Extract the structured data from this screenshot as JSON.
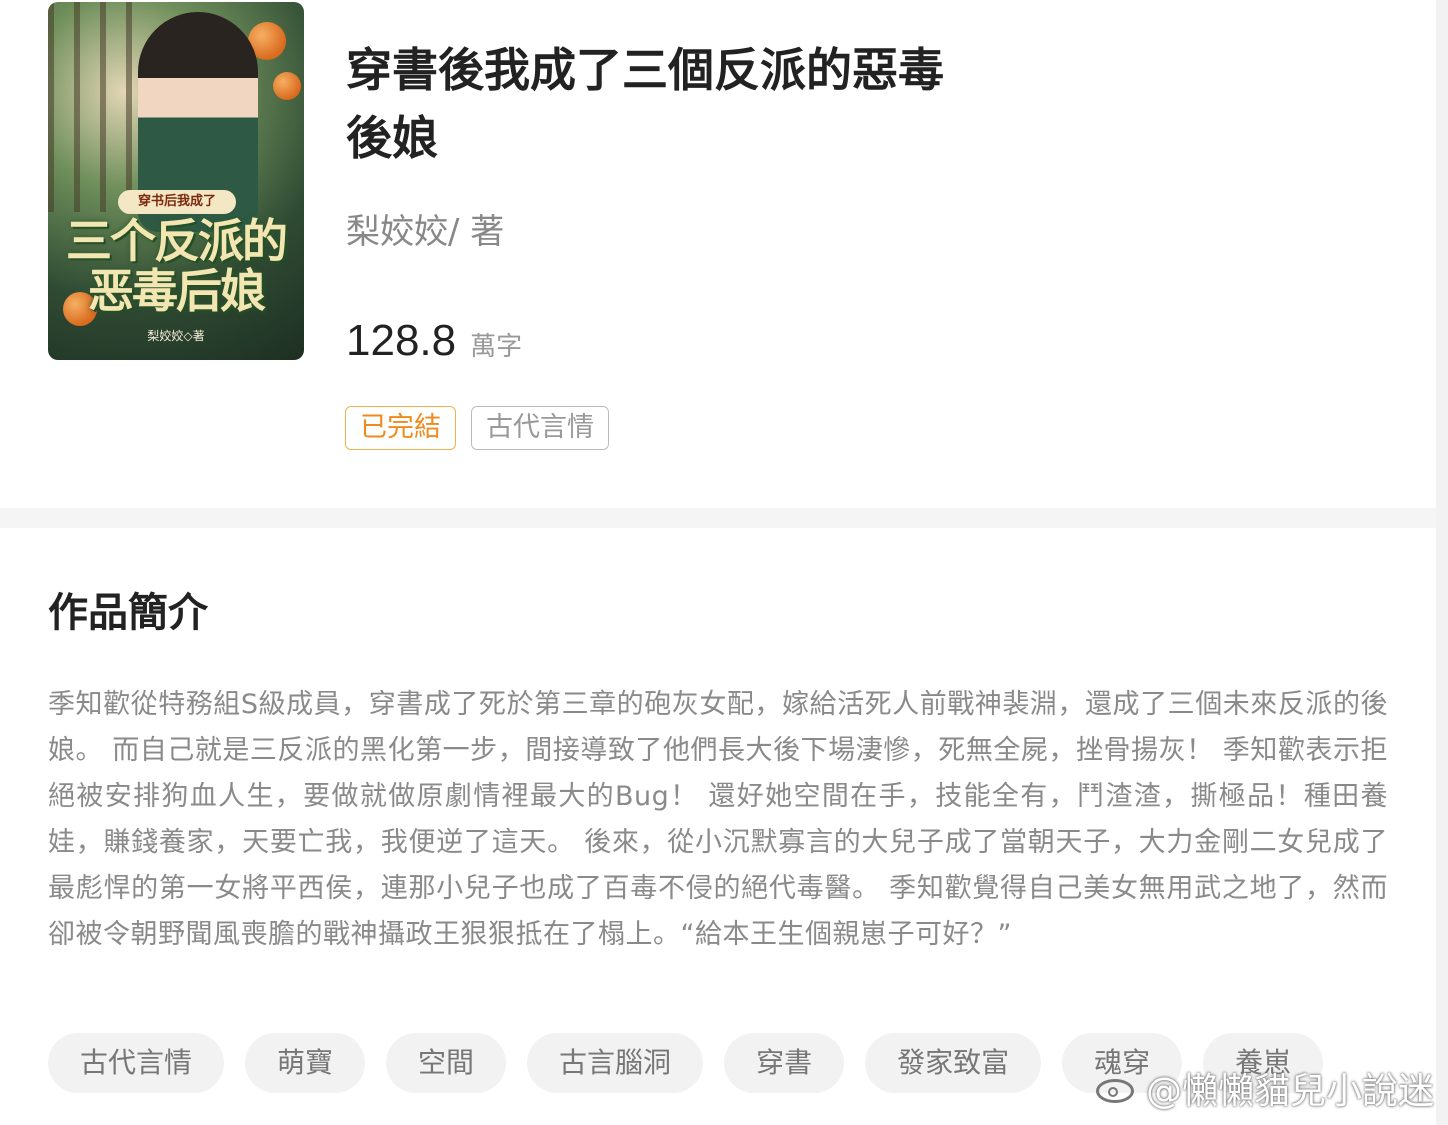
{
  "book": {
    "cover": {
      "subtitle_text": "穿书后我成了",
      "title_text": "三个反派的恶毒后娘",
      "author_text": "梨姣姣◇著"
    },
    "title": "穿書後我成了三個反派的惡毒後娘",
    "author": "梨姣姣/ 著",
    "word_count": "128.8",
    "word_unit": "萬字",
    "status_tag": "已完結",
    "genre_tag": "古代言情"
  },
  "intro": {
    "heading": "作品簡介",
    "text": "季知歡從特務組S級成員，穿書成了死於第三章的砲灰女配，嫁給活死人前戰神裴淵，還成了三個未來反派的後娘。 而自己就是三反派的黑化第一步，間接導致了他們長大後下場淒慘，死無全屍，挫骨揚灰！ 季知歡表示拒絕被安排狗血人生，要做就做原劇情裡最大的Bug！ 還好她空間在手，技能全有，鬥渣渣，撕極品！種田養娃，賺錢養家，天要亡我，我便逆了這天。 後來，從小沉默寡言的大兒子成了當朝天子，大力金剛二女兒成了最彪悍的第一女將平西侯，連那小兒子也成了百毒不侵的絕代毒醫。 季知歡覺得自己美女無用武之地了，然而卻被令朝野聞風喪膽的戰神攝政王狠狠抵在了榻上。“給本王生個親崽子可好？”"
  },
  "keywords": [
    "古代言情",
    "萌寶",
    "空間",
    "古言腦洞",
    "穿書",
    "發家致富",
    "魂穿",
    "養崽"
  ],
  "watermark": "@懶懶貓兒小說迷",
  "colors": {
    "status_accent": "#f08a1c",
    "status_border": "#f0b24a",
    "text_muted": "#8a8a8a"
  }
}
